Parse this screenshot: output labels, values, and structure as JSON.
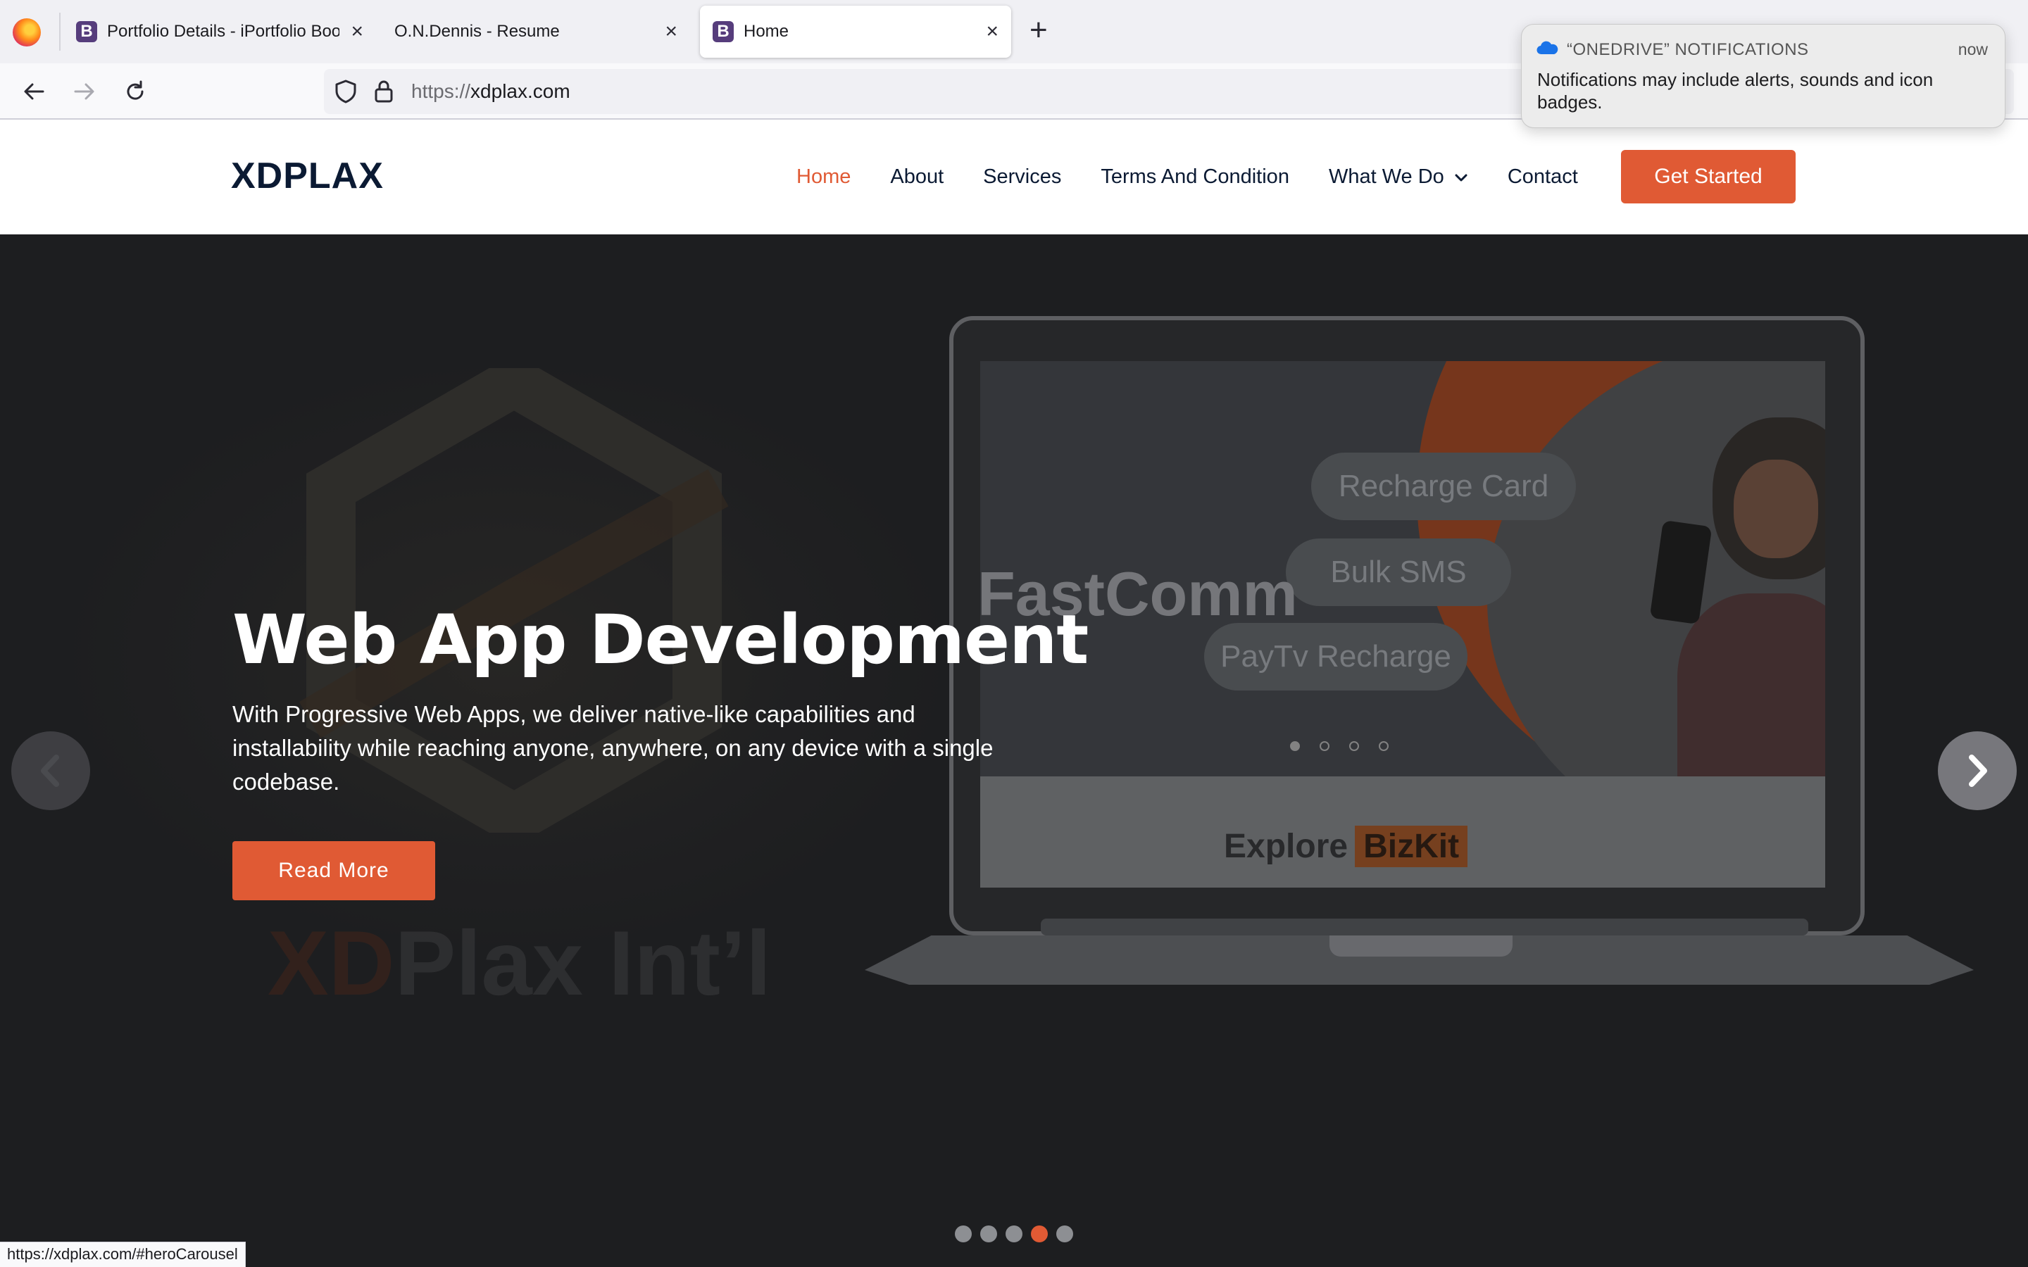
{
  "browser": {
    "tabs": [
      {
        "title": "Portfolio Details - iPortfolio Boo",
        "favicon": "B"
      },
      {
        "title": "O.N.Dennis - Resume",
        "favicon": ""
      },
      {
        "title": "Home",
        "favicon": "B",
        "active": true
      }
    ],
    "url_protocol": "https://",
    "url_host": "xdplax.com",
    "status_url": "https://xdplax.com/#heroCarousel"
  },
  "notification": {
    "app": "“ONEDRIVE” NOTIFICATIONS",
    "time": "now",
    "body": "Notifications may include alerts, sounds and icon badges."
  },
  "site": {
    "brand": "XDPLAX",
    "nav": [
      {
        "label": "Home",
        "active": true
      },
      {
        "label": "About"
      },
      {
        "label": "Services"
      },
      {
        "label": "Terms And Condition"
      },
      {
        "label": "What We Do",
        "dropdown": true
      },
      {
        "label": "Contact"
      }
    ],
    "cta": "Get Started"
  },
  "hero": {
    "title": "Web App Development",
    "description": "With Progressive Web Apps, we deliver native-like capabilities and installability while reaching anyone, anywhere, on any device with a single codebase.",
    "button": "Read More",
    "watermark_prefix": "XD",
    "watermark_rest": "Plax Int’l",
    "indicator_count": 5,
    "active_indicator": 4,
    "laptop_screen": {
      "headline": "FastComm",
      "pills": [
        "Recharge Card",
        "Bulk SMS",
        "PayTv Recharge"
      ],
      "explore": "Explore",
      "explore_brand": "BizKit"
    }
  },
  "colors": {
    "accent": "#e05a34",
    "brand_text": "#0b1a33"
  }
}
